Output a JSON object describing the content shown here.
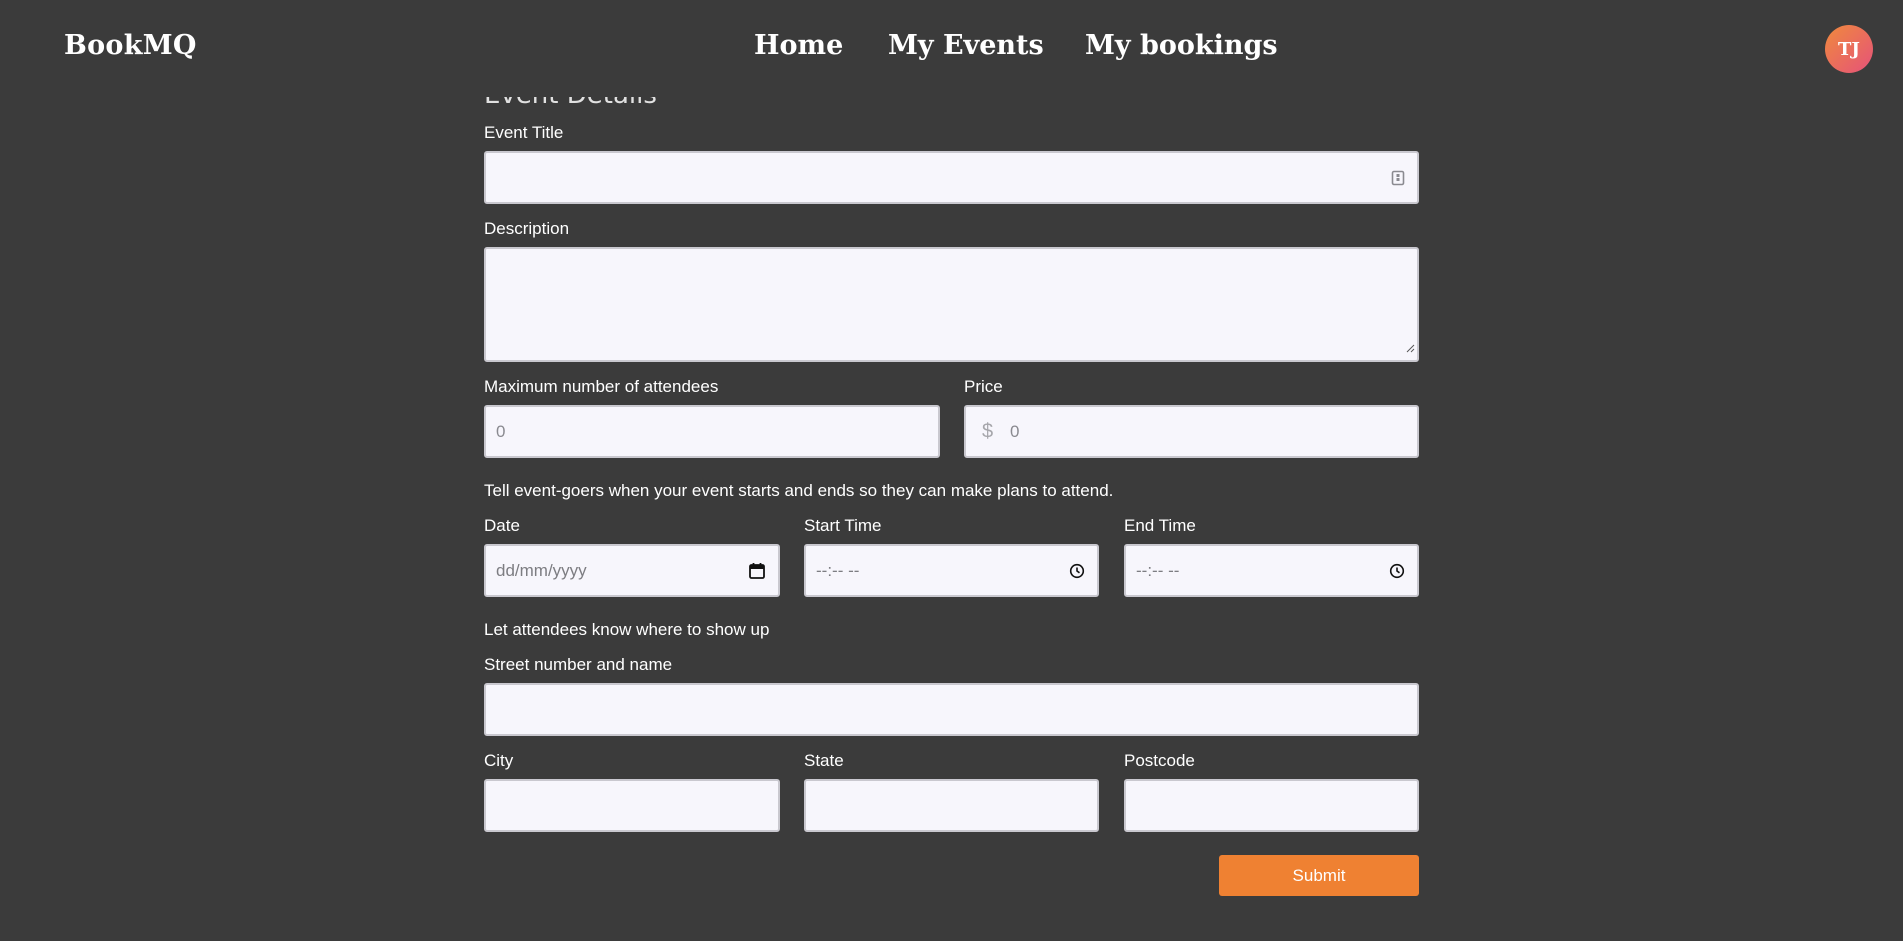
{
  "header": {
    "brand": "BookMQ",
    "nav": {
      "home": "Home",
      "my_events": "My Events",
      "my_bookings": "My bookings"
    },
    "avatar_initials": "TJ"
  },
  "form": {
    "section_heading": "Event Details",
    "title": {
      "label": "Event Title",
      "value": ""
    },
    "description": {
      "label": "Description",
      "value": ""
    },
    "max_attendees": {
      "label": "Maximum number of attendees",
      "placeholder": "0"
    },
    "price": {
      "label": "Price",
      "currency_symbol": "$",
      "placeholder": "0"
    },
    "schedule_hint": "Tell event-goers when your event starts and ends so they can make plans to attend.",
    "date": {
      "label": "Date",
      "placeholder": "dd/mm/yyyy"
    },
    "start_time": {
      "label": "Start Time",
      "placeholder": "--:-- --"
    },
    "end_time": {
      "label": "End Time",
      "placeholder": "--:-- --"
    },
    "location_hint": "Let attendees know where to show up",
    "street": {
      "label": "Street number and name",
      "value": ""
    },
    "city": {
      "label": "City",
      "value": ""
    },
    "state": {
      "label": "State",
      "value": ""
    },
    "postcode": {
      "label": "Postcode",
      "value": ""
    },
    "submit_label": "Submit"
  },
  "colors": {
    "background": "#3b3b3b",
    "field_background": "#f7f6fc",
    "accent": "#ef8132",
    "avatar_gradient_start": "#f08a3c",
    "avatar_gradient_end": "#e5527a"
  },
  "icons": [
    "clipboard-icon",
    "calendar-icon",
    "clock-icon",
    "resize-grip-icon"
  ]
}
